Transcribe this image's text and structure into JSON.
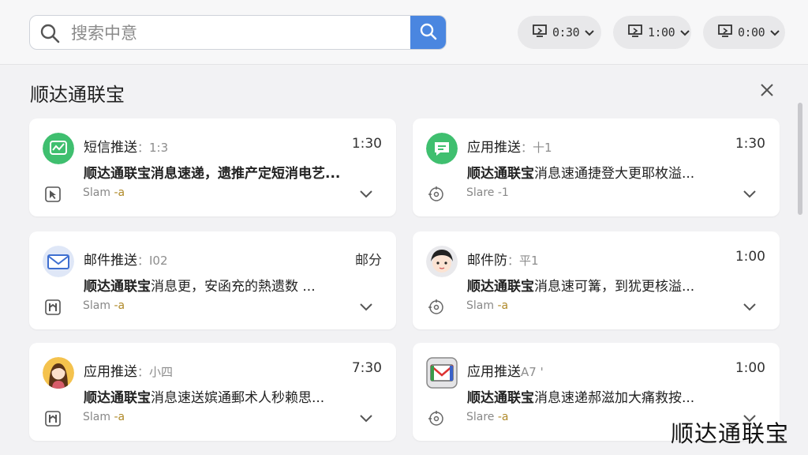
{
  "search": {
    "placeholder": "搜索中意"
  },
  "filters": [
    {
      "label": "0:30"
    },
    {
      "label": "1:00"
    },
    {
      "label": "0:00"
    }
  ],
  "section": {
    "title": "顺达通联宝"
  },
  "cards": [
    {
      "title": "短信推送",
      "sub": "：1:3",
      "time": "1:30",
      "body_bold": "顺达通联宝消息速递，遗推产定短消电艺...",
      "body_rest": "",
      "foot_prefix": "Slam",
      "foot_accent": "-a",
      "avatar_icon": "chart-bubble-icon",
      "foot_icon": "cursor-icon"
    },
    {
      "title": "应用推送",
      "sub": "：十1",
      "time": "1:30",
      "body_bold": "顺达通联宝",
      "body_rest": "消息速通捷登大更耶枚溢...",
      "foot_prefix": "Slare",
      "foot_accent": "-1",
      "avatar_icon": "message-bubble-icon",
      "foot_icon": "target-icon"
    },
    {
      "title": "邮件推送",
      "sub": "：I02",
      "time": "邮分",
      "body_bold": "顺达通联宝",
      "body_rest": "消息更，安函充的熱遗数 ...",
      "foot_prefix": "Slam",
      "foot_accent": "-a",
      "avatar_icon": "envelope-icon",
      "foot_icon": "h-box-icon"
    },
    {
      "title": "邮件防",
      "sub": "：平1",
      "time": "1:00",
      "body_bold": "顺达通联宝",
      "body_rest": "消息速可篝，到犹更核溢...",
      "foot_prefix": "Slam",
      "foot_accent": "-a",
      "avatar_icon": "person-avatar-icon",
      "foot_icon": "target-icon"
    },
    {
      "title": "应用推送",
      "sub": "：小四",
      "time": "7:30",
      "body_bold": "顺达通联宝",
      "body_rest": "消息速送嫔通郵术人秒赖思...",
      "foot_prefix": "Slam",
      "foot_accent": "-a",
      "avatar_icon": "woman-avatar-icon",
      "foot_icon": "h-box-icon"
    },
    {
      "title": "应用推送",
      "sub": "A7 '",
      "time": "1:00",
      "body_bold": "顺达通联宝",
      "body_rest": "消息速递郝滋加大痛救按...",
      "foot_prefix": "Slare",
      "foot_accent": "-a",
      "avatar_icon": "mail-app-icon",
      "foot_icon": "target-icon"
    }
  ],
  "watermark": "顺达通联宝",
  "colors": {
    "accent_blue": "#4a86e0",
    "green": "#3fbf6f",
    "background": "#f2f2f4"
  }
}
